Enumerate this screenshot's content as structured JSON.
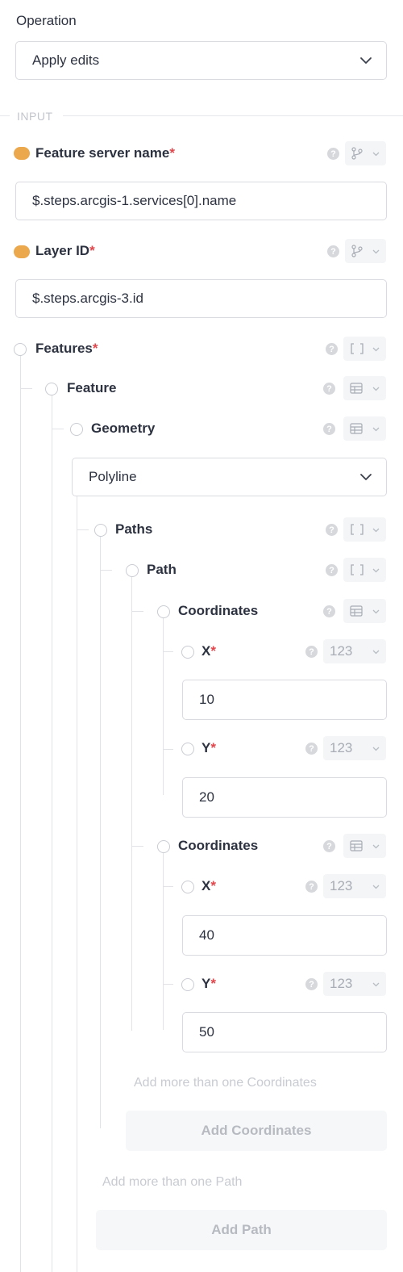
{
  "operation": {
    "label": "Operation",
    "selected": "Apply edits"
  },
  "section": {
    "input_label": "INPUT"
  },
  "feature_server": {
    "title": "Feature server name",
    "required_mark": "*",
    "value": "$.steps.arcgis-1.services[0].name"
  },
  "layer_id": {
    "title": "Layer ID",
    "required_mark": "*",
    "value": "$.steps.arcgis-3.id"
  },
  "features": {
    "title": "Features",
    "required_mark": "*"
  },
  "feature": {
    "title": "Feature"
  },
  "geometry": {
    "title": "Geometry",
    "selected": "Polyline"
  },
  "paths": {
    "title": "Paths"
  },
  "path": {
    "title": "Path"
  },
  "coordinates": [
    {
      "title": "Coordinates",
      "x_label": "X",
      "x_value": "10",
      "y_label": "Y",
      "y_value": "20"
    },
    {
      "title": "Coordinates",
      "x_label": "X",
      "x_value": "40",
      "y_label": "Y",
      "y_value": "50"
    }
  ],
  "required_mark": "*",
  "number_type": "123",
  "help_glyph": "?",
  "hints": {
    "more_coordinates": "Add more than one Coordinates",
    "more_path": "Add more than one Path"
  },
  "buttons": {
    "add_coordinates": "Add Coordinates",
    "add_path": "Add Path"
  },
  "colors": {
    "accent_dot": "#eba84d",
    "required": "#e0474c"
  }
}
